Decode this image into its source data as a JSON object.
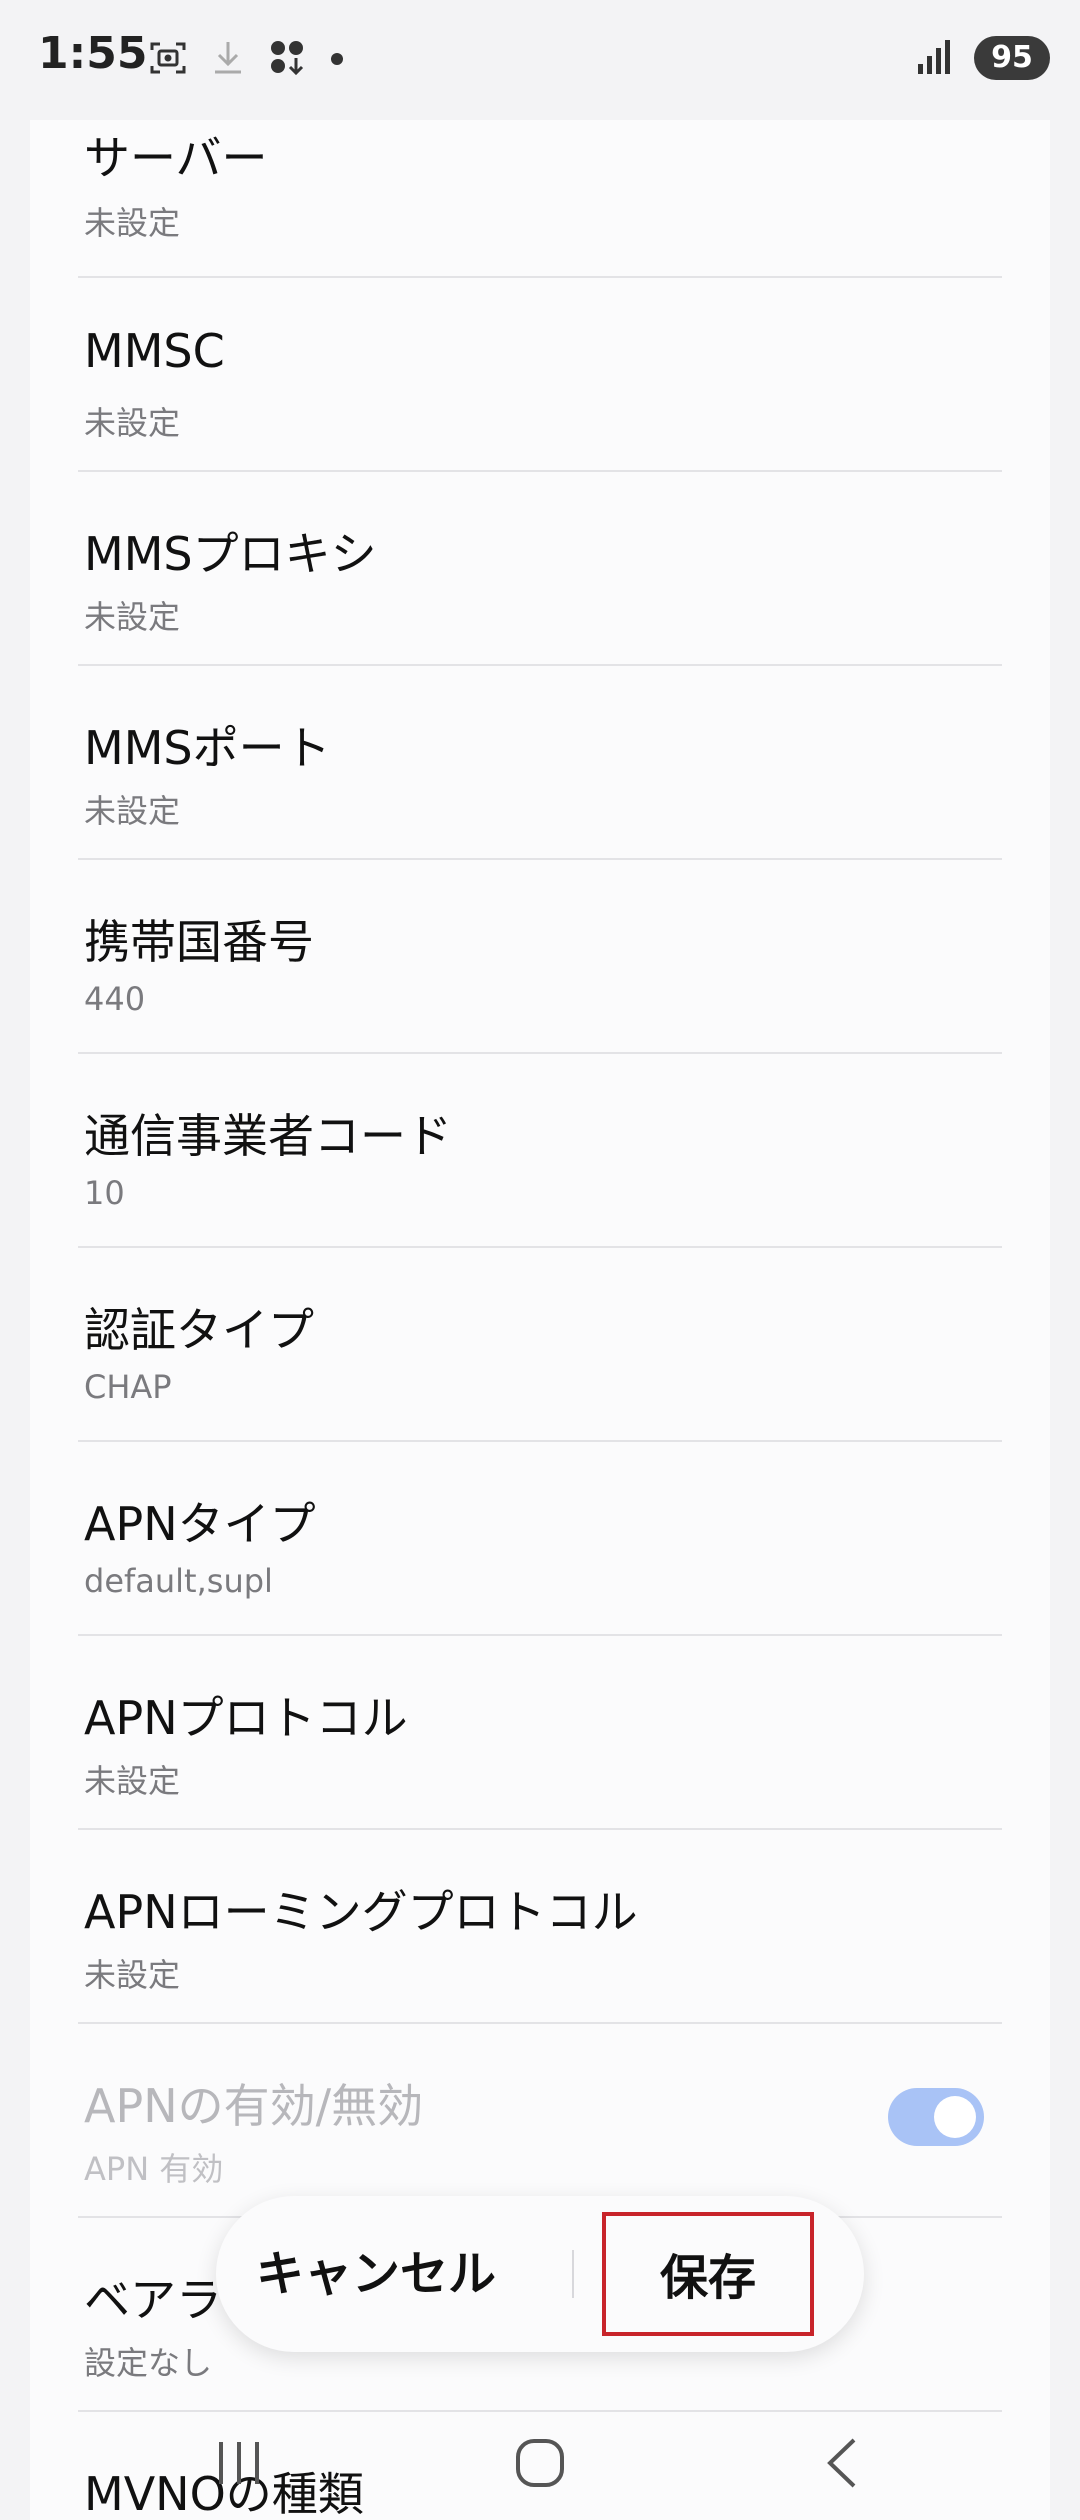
{
  "status_bar": {
    "time": "1:55",
    "battery": "95"
  },
  "settings": {
    "items": [
      {
        "title": "サーバー",
        "value": "未設定"
      },
      {
        "title": "MMSC",
        "value": "未設定"
      },
      {
        "title": "MMSプロキシ",
        "value": "未設定"
      },
      {
        "title": "MMSポート",
        "value": "未設定"
      },
      {
        "title": "携帯国番号",
        "value": "440"
      },
      {
        "title": "通信事業者コード",
        "value": "10"
      },
      {
        "title": "認証タイプ",
        "value": "CHAP"
      },
      {
        "title": "APNタイプ",
        "value": "default,supl"
      },
      {
        "title": "APNプロトコル",
        "value": "未設定"
      },
      {
        "title": "APNローミングプロトコル",
        "value": "未設定"
      },
      {
        "title": "APNの有効/無効",
        "value": "APN 有効",
        "toggle_on": true
      },
      {
        "title": "ベアラ",
        "value": "設定なし"
      },
      {
        "title": "MVNOの種類",
        "value": ""
      }
    ]
  },
  "actions": {
    "cancel_label": "キャンセル",
    "save_label": "保存"
  },
  "colors": {
    "toggle_on": "#a9c3f6",
    "save_outline": "#c8242a",
    "background": "#f3f3f5"
  },
  "icons": {
    "status_left": [
      "screenshot-icon",
      "download-icon",
      "app-notification-icon",
      "dot-icon"
    ],
    "status_right": [
      "signal-icon",
      "battery-icon"
    ],
    "nav": [
      "recents-icon",
      "home-icon",
      "back-icon"
    ]
  }
}
